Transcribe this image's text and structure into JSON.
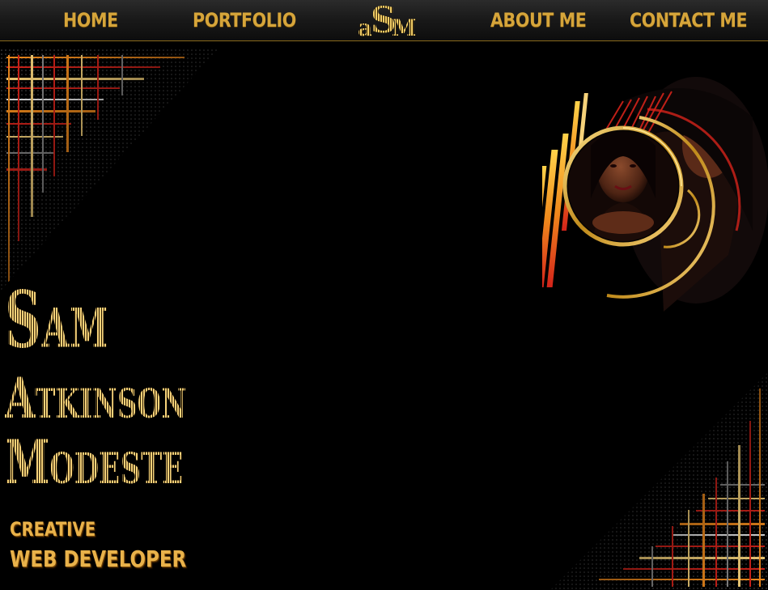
{
  "nav": {
    "home": "HOME",
    "portfolio": "PORTFOLIO",
    "logo": {
      "a": "a",
      "s": "S",
      "m": "M"
    },
    "about": "ABOUT ME",
    "contact": "CONTACT ME"
  },
  "hero": {
    "name_first": "Sam",
    "name_middle": "Atkinson",
    "name_last": "Modeste",
    "tagline_line1": "CREATIVE",
    "tagline_line2": "WEB DEVELOPER"
  },
  "colors": {
    "gold": "#d6a53a",
    "gold_light": "#f6d27a",
    "accent_red": "#d4231a",
    "accent_orange": "#f08a1c",
    "background": "#000000"
  },
  "icons": {
    "portrait": "profile-photo",
    "corner_top_left": "decorative-grid-corner",
    "corner_bottom_right": "decorative-grid-corner"
  }
}
